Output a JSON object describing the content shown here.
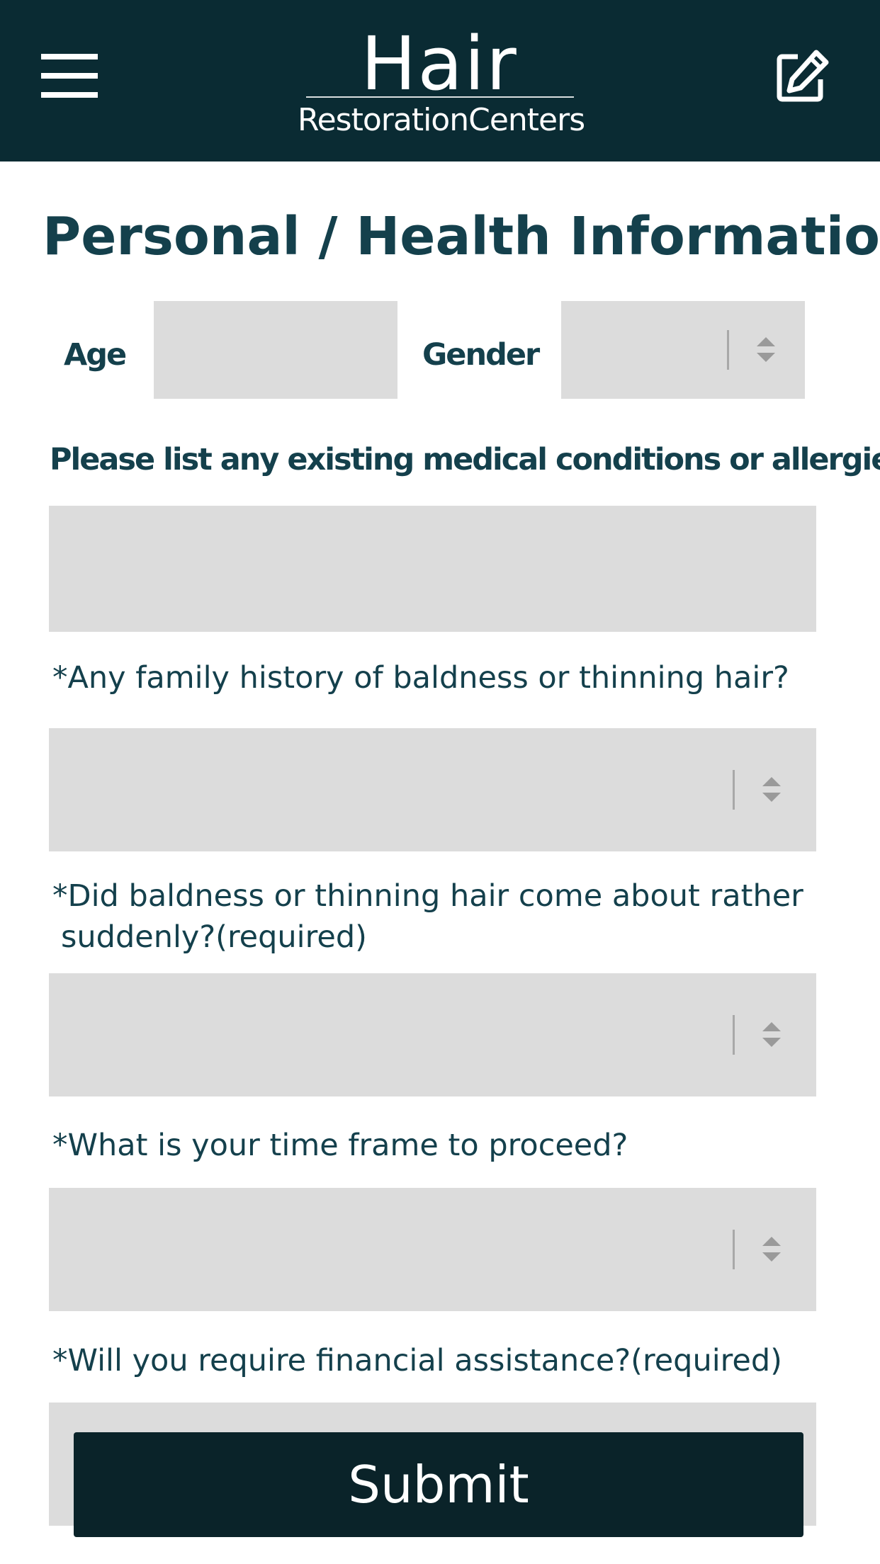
{
  "header": {
    "logo_line1": "Hair",
    "logo_line2": "RestorationCenters",
    "menu_icon": "hamburger-menu-icon",
    "edit_icon": "edit-note-icon",
    "background_color": "#0a2b33"
  },
  "form": {
    "title": "Personal / Health Information",
    "age_label": "Age",
    "age_value": "",
    "gender_label": "Gender",
    "gender_value": "",
    "medical_label": "Please list any existing medical conditions or allergies:",
    "medical_value": "",
    "family_history_label": "*Any family history of baldness or thinning hair?",
    "family_history_value": "",
    "sudden_label_line1": "*Did baldness or thinning hair come about rather",
    "sudden_label_line2": "suddenly?(required)",
    "sudden_value": "",
    "timeframe_label": "*What is your time frame to proceed?",
    "timeframe_value": "",
    "financial_label": "*Will you require financial assistance?(required)",
    "financial_value": "",
    "submit_label": "Submit"
  },
  "colors": {
    "accent": "#14404c",
    "field_bg": "#dcdcdc",
    "button_bg": "#0a2329"
  }
}
